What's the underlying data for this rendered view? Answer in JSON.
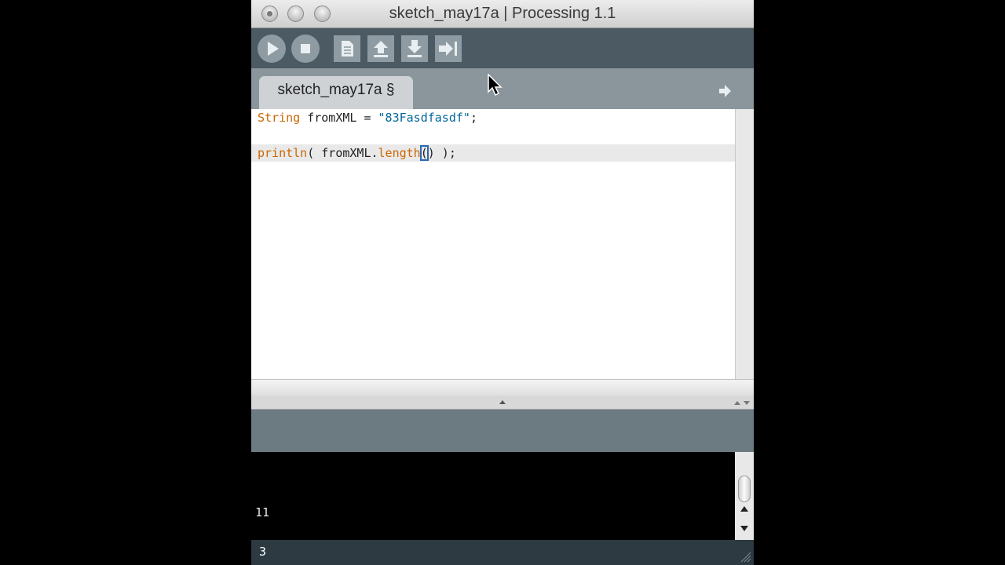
{
  "window": {
    "title": "sketch_may17a | Processing 1.1"
  },
  "toolbar": {
    "buttons": [
      {
        "name": "run",
        "icon": "play-icon"
      },
      {
        "name": "stop",
        "icon": "stop-icon"
      },
      {
        "name": "new",
        "icon": "new-file-icon"
      },
      {
        "name": "open",
        "icon": "open-arrow-up-icon"
      },
      {
        "name": "save",
        "icon": "save-arrow-down-icon"
      },
      {
        "name": "export",
        "icon": "export-arrow-icon"
      }
    ]
  },
  "tabs": {
    "active": "sketch_may17a §",
    "menu_icon": "arrow-right-icon"
  },
  "editor": {
    "line1": {
      "type": "String",
      "rest": " fromXML = ",
      "string": "\"83Fasdfasdf\"",
      "end": ";"
    },
    "line2": {
      "fn": "println",
      "open": "( fromXML.",
      "method": "length",
      "paren_open": "(",
      "paren_close": ")",
      "end": " );"
    }
  },
  "console": {
    "output": "11"
  },
  "status": {
    "line_number": "3"
  },
  "colors": {
    "keyword": "#cc6600",
    "string": "#006699",
    "toolbar": "#4b5a63",
    "status": "#2d3a41"
  }
}
